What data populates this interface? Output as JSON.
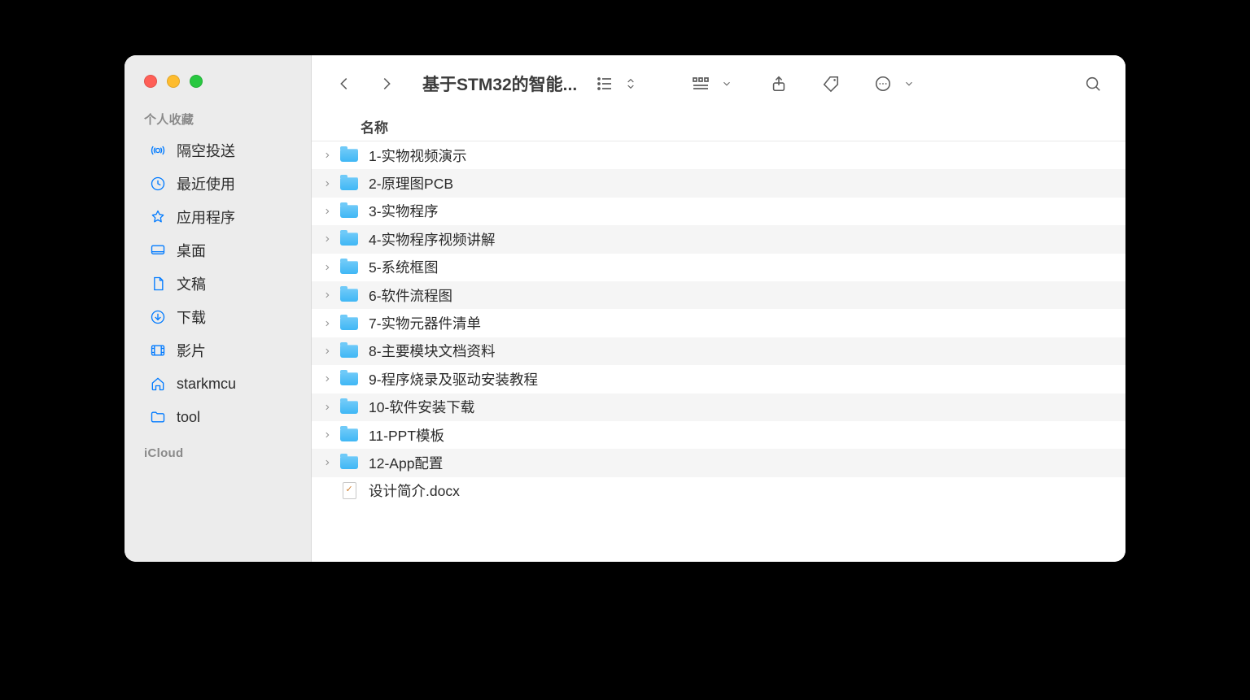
{
  "window": {
    "title": "基于STM32的智能..."
  },
  "sidebar": {
    "section_favorites": "个人收藏",
    "section_icloud": "iCloud",
    "items": [
      {
        "label": "隔空投送",
        "icon": "airdrop"
      },
      {
        "label": "最近使用",
        "icon": "clock"
      },
      {
        "label": "应用程序",
        "icon": "apps"
      },
      {
        "label": "桌面",
        "icon": "desktop"
      },
      {
        "label": "文稿",
        "icon": "document"
      },
      {
        "label": "下载",
        "icon": "download"
      },
      {
        "label": "影片",
        "icon": "movie"
      },
      {
        "label": "starkmcu",
        "icon": "home"
      },
      {
        "label": "tool",
        "icon": "folder"
      }
    ]
  },
  "list": {
    "column_name": "名称",
    "items": [
      {
        "type": "folder",
        "label": "1-实物视频演示"
      },
      {
        "type": "folder",
        "label": "2-原理图PCB"
      },
      {
        "type": "folder",
        "label": "3-实物程序"
      },
      {
        "type": "folder",
        "label": "4-实物程序视频讲解"
      },
      {
        "type": "folder",
        "label": "5-系统框图"
      },
      {
        "type": "folder",
        "label": "6-软件流程图"
      },
      {
        "type": "folder",
        "label": "7-实物元器件清单"
      },
      {
        "type": "folder",
        "label": "8-主要模块文档资料"
      },
      {
        "type": "folder",
        "label": "9-程序烧录及驱动安装教程"
      },
      {
        "type": "folder",
        "label": "10-软件安装下载"
      },
      {
        "type": "folder",
        "label": "11-PPT模板"
      },
      {
        "type": "folder",
        "label": "12-App配置"
      },
      {
        "type": "docx",
        "label": "设计简介.docx"
      }
    ]
  }
}
